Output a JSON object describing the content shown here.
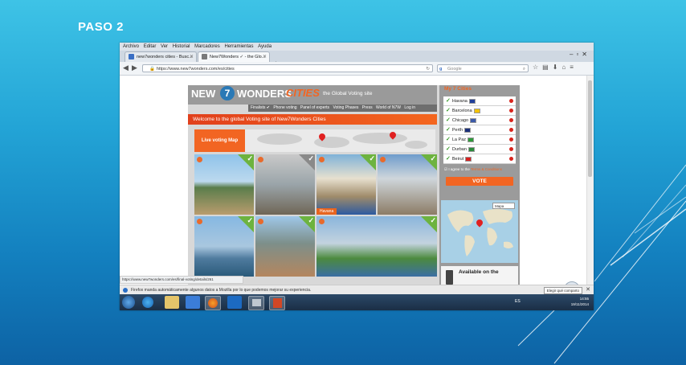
{
  "slide": {
    "title": "PASO 2"
  },
  "browser": {
    "menu": [
      "Archivo",
      "Editar",
      "Ver",
      "Historial",
      "Marcadores",
      "Herramientas",
      "Ayuda"
    ],
    "tabs": [
      {
        "label": "new7wonders cities - Busc...",
        "active": false
      },
      {
        "label": "New7Wonders ✓ - the Glo...",
        "active": true
      }
    ],
    "new_tab": "+",
    "url": "https://www.new7wonders.com/es/cities",
    "search_placeholder": "Google",
    "status_url": "https://www.new7wonders.com/es/final-voting/details/261",
    "notification": "Firefox manda automáticamente algunos datos a Mozilla por lo que podemos mejorar su experiencia.",
    "notification_button": "Elegir qué comparto"
  },
  "site": {
    "logo_new": "NEW",
    "logo_seven": "7",
    "logo_wonders": "WONDERS",
    "logo_cities": "CITIES",
    "tagline": "the Global Voting site",
    "nav": [
      "Finalists ✔",
      "Phone voting",
      "Panel of experts",
      "Voting Phases",
      "Press",
      "World of N7W",
      "Log in"
    ],
    "welcome": "Welcome to the global Voting site of New7Wonders Cities",
    "live_map": "Live voting Map",
    "tile_caption": "Havana",
    "my7_title": "My 7 Cities",
    "cities": [
      {
        "name": "Havana",
        "flag": "#1f3f9a"
      },
      {
        "name": "Barcelona",
        "flag": "#f2c200"
      },
      {
        "name": "Chicago",
        "flag": "#3c5aa8"
      },
      {
        "name": "Perth",
        "flag": "#1a2f7a"
      },
      {
        "name": "La Paz",
        "flag": "#2e9a3a"
      },
      {
        "name": "Durban",
        "flag": "#2a8a3a"
      },
      {
        "name": "Beirut",
        "flag": "#d62020"
      }
    ],
    "agree_prefix": "I agree to the",
    "agree_terms": "Terms & Conditions",
    "vote_button": "VOTE",
    "map_select": "Mapa",
    "available": "Available on the"
  },
  "taskbar": {
    "lang": "ES",
    "time": "14:55",
    "date": "19/11/2014"
  },
  "colors": {
    "accent": "#f26522",
    "check": "#6db33f"
  }
}
